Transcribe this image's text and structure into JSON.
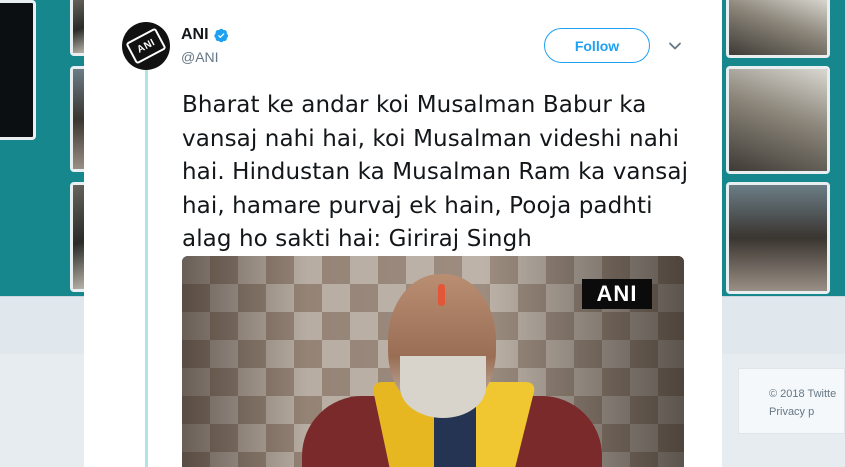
{
  "tweet": {
    "display_name": "ANI",
    "handle": "@ANI",
    "follow_label": "Follow",
    "avatar_text": "ANI",
    "text": "Bharat ke andar koi Musalman Babur ka vansaj nahi hai, koi Musalman videshi nahi hai. Hindustan ka Musalman Ram ka vansaj hai, hamare purvaj ek hain, Pooja padhti alag ho sakti hai: Giriraj Singh",
    "media_watermark": "ANI"
  },
  "footer": {
    "copyright": "© 2018 Twitte",
    "privacy": "Privacy p"
  },
  "colors": {
    "accent": "#1da1f2",
    "header_bg": "#15878d",
    "thread_line": "#aee6e6"
  },
  "icons": {
    "verified": "verified-badge-icon",
    "more": "chevron-down-icon"
  }
}
